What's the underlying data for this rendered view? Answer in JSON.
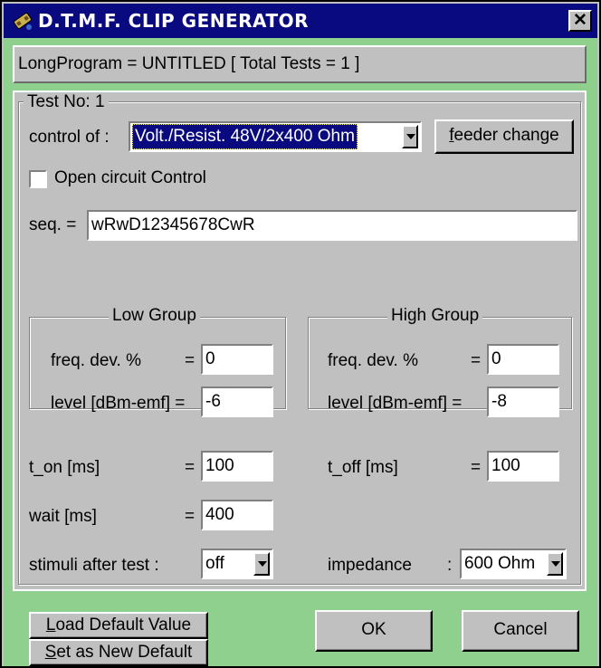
{
  "window": {
    "title": "D.T.M.F. CLIP GENERATOR",
    "close_glyph": "✕"
  },
  "status": {
    "text": "LongProgram = UNTITLED  [ Total Tests =  1 ]"
  },
  "test": {
    "label": "Test No:  1",
    "control_label": "control of :",
    "control_value": "Volt./Resist. 48V/2x400 Ohm",
    "feeder_button_first": "f",
    "feeder_button_rest": "eeder change",
    "open_circuit_label": "Open circuit Control",
    "open_circuit_checked": false,
    "seq_label": "seq. =",
    "seq_value": "wRwD12345678CwR"
  },
  "low_group": {
    "title": "Low Group",
    "freq_label": "freq. dev. %",
    "freq_eq": "=",
    "freq_value": "0",
    "level_label": "level  [dBm-emf] =",
    "level_value": "-6"
  },
  "high_group": {
    "title": "High Group",
    "freq_label": "freq. dev. %",
    "freq_eq": "=",
    "freq_value": "0",
    "level_label": "level  [dBm-emf]  =",
    "level_value": "-8"
  },
  "timing": {
    "t_on_label": "t_on [ms]",
    "t_on_eq": "=",
    "t_on_value": "100",
    "t_off_label": "t_off [ms]",
    "t_off_eq": "=",
    "t_off_value": "100",
    "wait_label": "wait [ms]",
    "wait_eq": "=",
    "wait_value": "400",
    "stimuli_label": "stimuli after test :",
    "stimuli_value": "off",
    "impedance_label": "impedance",
    "impedance_colon": ":",
    "impedance_value": "600 Ohm"
  },
  "buttons": {
    "load_first": "L",
    "load_rest": "oad Default Value",
    "set_first": "S",
    "set_rest": "et as New Default",
    "ok": "OK",
    "cancel": "Cancel"
  },
  "colors": {
    "titlebar": "#0a0a80",
    "background_green": "#8fd08f",
    "face": "#c0c0c0",
    "selection": "#0a0a80"
  }
}
